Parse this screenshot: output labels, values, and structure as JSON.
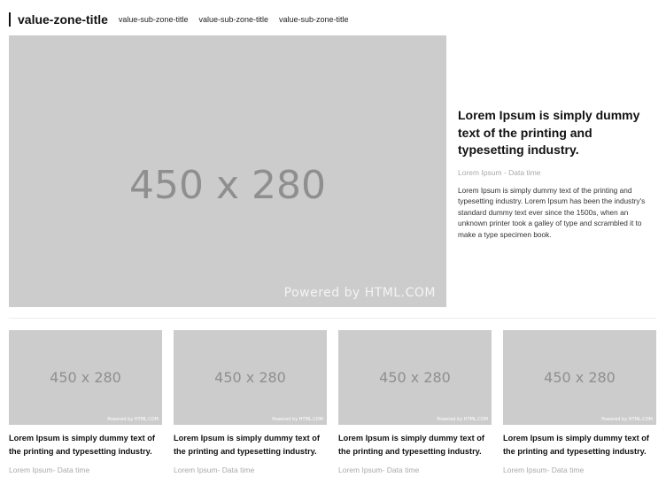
{
  "zone": {
    "title": "value-zone-title",
    "sub_tabs": [
      "value-sub-zone-title",
      "value-sub-zone-title",
      "value-sub-zone-title"
    ]
  },
  "featured": {
    "image": {
      "size_label": "450 x 280",
      "powered_label": "Powered by HTML.COM"
    },
    "title": "Lorem Ipsum is simply dummy text of the printing and typesetting industry.",
    "meta": "Lorem Ipsum - Data time",
    "summary": "Lorem Ipsum is simply dummy text of the printing and typesetting industry. Lorem Ipsum has been the industry's standard dummy text ever since the 1500s, when an unknown printer took a galley of type and scrambled it to make a type specimen book."
  },
  "cards": [
    {
      "size_label": "450 x 280",
      "powered_label": "Powered by HTML.COM",
      "title": "Lorem Ipsum is simply dummy text of the printing and typesetting industry.",
      "meta": "Lorem Ipsum- Data time"
    },
    {
      "size_label": "450 x 280",
      "powered_label": "Powered by HTML.COM",
      "title": "Lorem Ipsum is simply dummy text of the printing and typesetting industry.",
      "meta": "Lorem Ipsum- Data time"
    },
    {
      "size_label": "450 x 280",
      "powered_label": "Powered by HTML.COM",
      "title": "Lorem Ipsum is simply dummy text of the printing and typesetting industry.",
      "meta": "Lorem Ipsum- Data time"
    },
    {
      "size_label": "450 x 280",
      "powered_label": "Powered by HTML.COM",
      "title": "Lorem Ipsum is simply dummy text of the printing and typesetting industry.",
      "meta": "Lorem Ipsum- Data time"
    }
  ]
}
